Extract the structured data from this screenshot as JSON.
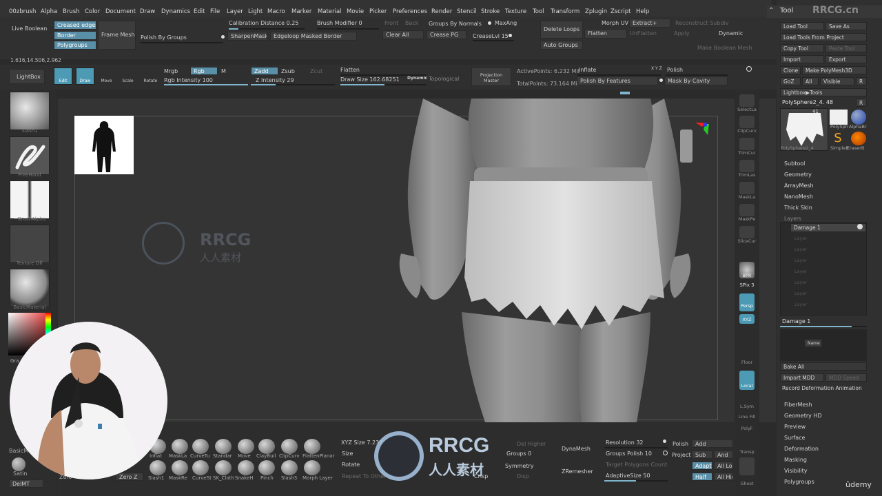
{
  "menubar": {
    "items": [
      "00zbrush",
      "Alpha",
      "Brush",
      "Color",
      "Document",
      "Draw",
      "Dynamics",
      "Edit",
      "File",
      "Layer",
      "Light",
      "Macro",
      "Marker",
      "Material",
      "Movie",
      "Picker",
      "Preferences",
      "Render",
      "Stencil",
      "Stroke",
      "Texture",
      "Tool",
      "Transform",
      "Zplugin",
      "Zscript",
      "Help"
    ]
  },
  "topbar": {
    "live_boolean": "Live Boolean",
    "creased_edges": "Creased edges",
    "border": "Border",
    "polygroups": "Polygroups",
    "frame_mesh": "Frame Mesh",
    "polish_by_groups": "Polish By Groups",
    "calibration_distance": "Calibration Distance 0.25",
    "sharpen_mask": "SharpenMask",
    "edgeloop_masked_border": "Edgeloop Masked Border",
    "brush_modifier": "Brush Modifier 0",
    "front": "Front",
    "back": "Back",
    "clear_all": "Clear All",
    "groups_by_normals": "Groups By Normals",
    "maxang": "MaxAng",
    "crease_pg": "Crease PG",
    "crease_lvl": "CreaseLvl 15",
    "delete_loops": "Delete Loops",
    "auto_groups": "Auto Groups",
    "morph_uv": "Morph UV",
    "extract": "Extract+",
    "reconstruct_subdiv": "Reconstruct Subdiv",
    "flatten": "Flatten",
    "unflatten": "UnFlatten",
    "apply": "Apply",
    "dynamic": "Dynamic",
    "make_boolean_mesh": "Make Boolean Mesh"
  },
  "coords": "1.616,14.506,2.962",
  "toolbar": {
    "lightbox": "LightBox",
    "edit": "Edit",
    "draw": "Draw",
    "move": "Move",
    "scale": "Scale",
    "rotate": "Rotate",
    "mrgb": "Mrgb",
    "rgb": "Rgb",
    "m": "M",
    "rgb_intensity": "Rgb Intensity 100",
    "zadd": "Zadd",
    "zsub": "Zsub",
    "zcut": "Zcut",
    "z_intensity": "Z Intensity 29",
    "flatten": "Flatten",
    "draw_size": "Draw Size 162.68251",
    "dynamic": "Dynamic",
    "topological": "Topological",
    "projection_master": "Projection Master",
    "active_points": "ActivePoints: 6.232 Mil",
    "total_points": "TotalPoints: 73.164 Mil",
    "inflate": "Inflate",
    "polish_by_features": "Polish By Features",
    "xyz": "X Y Z",
    "polish": "Polish",
    "mask_by_cavity": "Mask By Cavity"
  },
  "left_shelf": [
    {
      "caption": "Slash1"
    },
    {
      "caption": "FreeHand"
    },
    {
      "caption": "~BrushAlpha"
    },
    {
      "caption": "Texture Off"
    },
    {
      "caption": "BasicMaterial"
    }
  ],
  "gradient_label": "Gra",
  "right_dock": [
    "SelectLa",
    "ClipCurv",
    "TrimCur",
    "TrimLas",
    "MaskLa",
    "MaskPe",
    "SliceCur",
    "BPR",
    "SPix 3",
    "Persp",
    "XYZ",
    "Floor",
    "Local",
    "L.Sym",
    "Line Fill",
    "PolyF",
    "Transp",
    "Ghost"
  ],
  "right_panel": {
    "title": "Tool",
    "load_tool": "Load Tool",
    "save_as": "Save As",
    "load_tools_from_project": "Load Tools From Project",
    "copy_tool": "Copy Tool",
    "paste_tool": "Paste Tool",
    "import": "Import",
    "export": "Export",
    "clone": "Clone",
    "make_polymesh3d": "Make PolyMesh3D",
    "goz": "GoZ",
    "all": "All",
    "visible": "Visible",
    "r": "R",
    "lightbox_tools": "Lightbox▶Tools",
    "current_tool": "PolySphere2_4. 48",
    "tool_thumbs": [
      "PolySphere2_4",
      "PolySph",
      "AlphaBr",
      "SimpleB",
      "EraserB"
    ],
    "thumb_count": "41",
    "sections": [
      "Subtool",
      "Geometry",
      "ArrayMesh",
      "NanoMesh",
      "Thick Skin"
    ],
    "layers_title": "Layers",
    "layer_name": "Damage 1",
    "layer_rows": [
      "Layer",
      "Layer",
      "Layer",
      "Layer",
      "Layer",
      "Layer",
      "Layer"
    ],
    "damage_label": "Damage 1",
    "name_btn": "Name",
    "bake_all": "Bake All",
    "import_mdd": "Import MDD",
    "mdd_speed": "MDD Speed",
    "record_deformation": "Record Deformation Animation",
    "sections2": [
      "FiberMesh",
      "Geometry HD",
      "Preview",
      "Surface",
      "Deformation",
      "Masking",
      "Visibility",
      "Polygroups"
    ]
  },
  "bottom": {
    "brushes_row1": [
      "Inflat",
      "MaskLa",
      "CurveTu",
      "Standar",
      "Move",
      "ClayBuil",
      "ClipCurv",
      "FlattenPlanar"
    ],
    "brushes_row2": [
      "Slash1",
      "MaskRe",
      "CurveSt",
      "SK_Cloth",
      "SnakeH",
      "Pinch",
      "Slash3",
      "Morph Layer"
    ],
    "left_labels": [
      "BasicM",
      "Satin",
      "DelMT"
    ],
    "zero_z": "Zero Z",
    "zero": "Zero",
    "xyz_size": "XYZ Size 7.237",
    "size": "Size",
    "rotate": "Rotate",
    "repeat_to_other": "Repeat To Other",
    "del_higher": "Del Higher",
    "groups": "Groups 0",
    "symmetry": "Symmetry",
    "crisp": "Crisp",
    "disp": "Disp",
    "dynamesh": "DynaMesh",
    "zremesher": "ZRemesher",
    "resolution": "Resolution 32",
    "groups_polish": "Groups  Polish 10",
    "target_polygons": "Target Polygons Count",
    "adaptive_size": "AdaptiveSize 50",
    "polish": "Polish",
    "project": "Project",
    "add": "Add",
    "sub": "Sub",
    "and": "And",
    "adapt": "Adapt",
    "all_low": "All Low",
    "half": "Half",
    "all_high": "All High"
  },
  "watermarks": {
    "corner": "RRCG.cn",
    "brand": "RRCG",
    "brand_cn": "人人素材",
    "udemy": "ûdemy"
  },
  "colors": {
    "accent": "#5a9fbf",
    "canvas": "#343434",
    "panel": "#303030"
  }
}
